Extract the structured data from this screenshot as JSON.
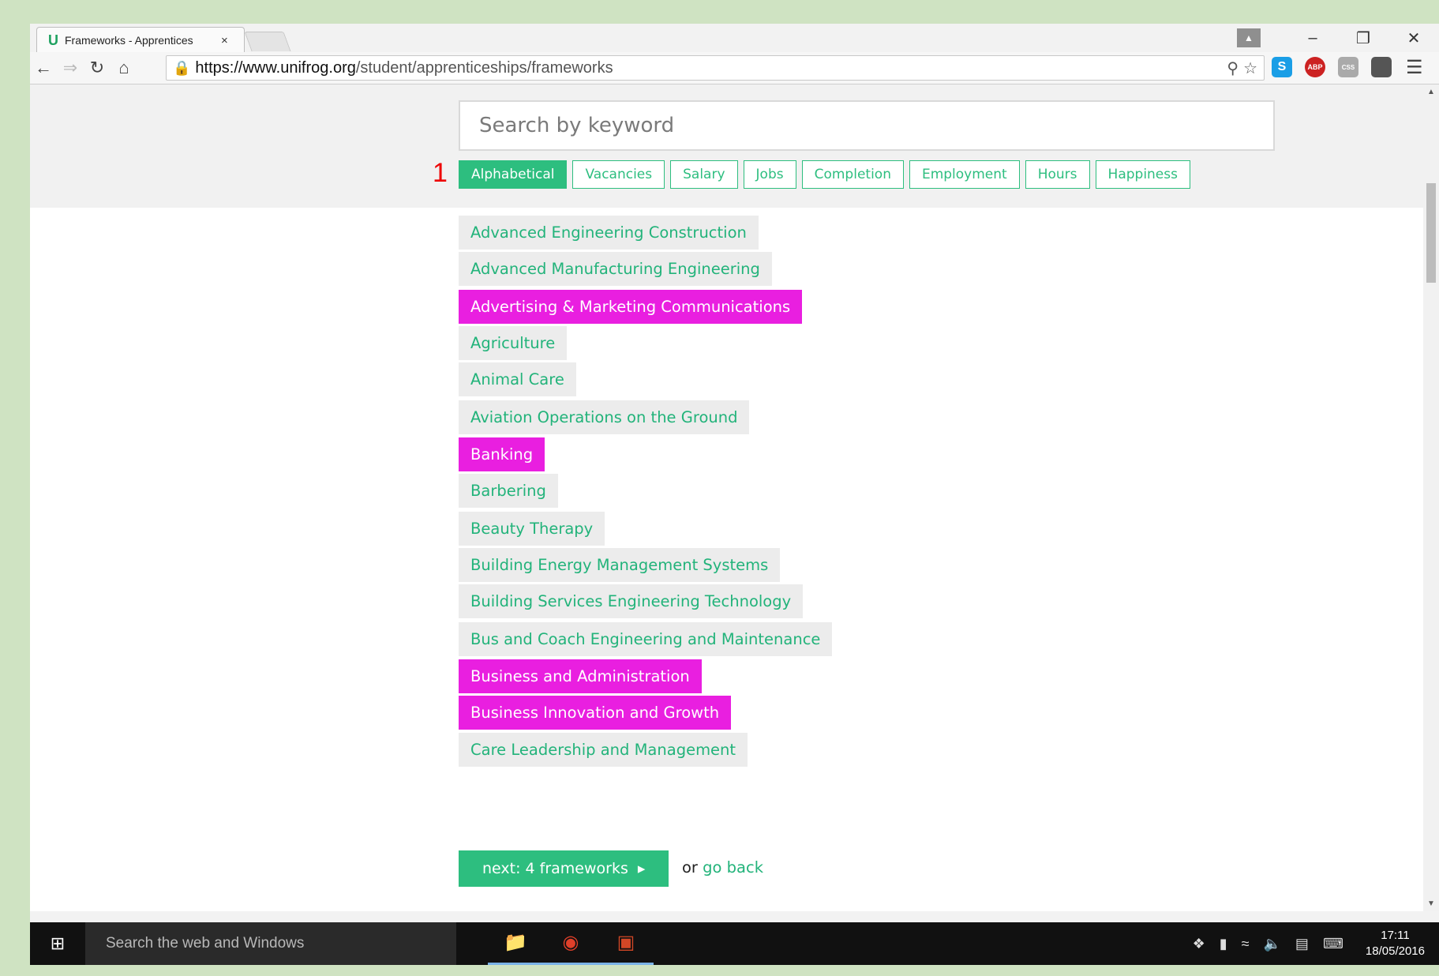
{
  "browser": {
    "tab_title": "Frameworks - Apprentices",
    "tab_favicon": "U",
    "tab_close": "×",
    "url_host": "https://www.unifrog.org",
    "url_path": "/student/apprenticeships/frameworks",
    "icons": [
      "back-arrow-icon",
      "forward-arrow-icon",
      "reload-icon",
      "home-icon",
      "lock-icon",
      "zoom-icon",
      "star-icon",
      "skype-icon",
      "adblock-icon",
      "css-extension-icon",
      "extension-icon",
      "menu-icon"
    ],
    "ext_abp": "ABP",
    "ext_skype": "S",
    "ext_css": "CSS"
  },
  "page": {
    "search_placeholder": "Search by keyword",
    "marker": "1",
    "sort_tabs": [
      {
        "label": "Alphabetical",
        "active": true
      },
      {
        "label": "Vacancies",
        "active": false
      },
      {
        "label": "Salary",
        "active": false
      },
      {
        "label": "Jobs",
        "active": false
      },
      {
        "label": "Completion",
        "active": false
      },
      {
        "label": "Employment",
        "active": false
      },
      {
        "label": "Hours",
        "active": false
      },
      {
        "label": "Happiness",
        "active": false
      }
    ],
    "frameworks": [
      {
        "label": "Advanced Engineering Construction",
        "selected": false
      },
      {
        "label": "Advanced Manufacturing Engineering",
        "selected": false
      },
      {
        "label": "Advertising & Marketing Communications",
        "selected": true
      },
      {
        "label": "Agriculture",
        "selected": false
      },
      {
        "label": "Animal Care",
        "selected": false
      },
      {
        "label": "Aviation Operations on the Ground",
        "selected": false
      },
      {
        "label": "Banking",
        "selected": true
      },
      {
        "label": "Barbering",
        "selected": false
      },
      {
        "label": "Beauty Therapy",
        "selected": false
      },
      {
        "label": "Building Energy Management Systems",
        "selected": false
      },
      {
        "label": "Building Services Engineering Technology",
        "selected": false
      },
      {
        "label": "Bus and Coach Engineering and Maintenance",
        "selected": false
      },
      {
        "label": "Business and Administration",
        "selected": true
      },
      {
        "label": "Business Innovation and Growth",
        "selected": true
      },
      {
        "label": "Care Leadership and Management",
        "selected": false
      }
    ],
    "next_button": "next: 4 frameworks",
    "next_arrow": "▸",
    "or_text": "or ",
    "go_back": "go back"
  },
  "taskbar": {
    "search_placeholder": "Search the web and Windows",
    "time": "17:11",
    "date": "18/05/2016"
  },
  "colors": {
    "accent_green": "#2dbe7f",
    "selected_magenta": "#e91fe0"
  }
}
